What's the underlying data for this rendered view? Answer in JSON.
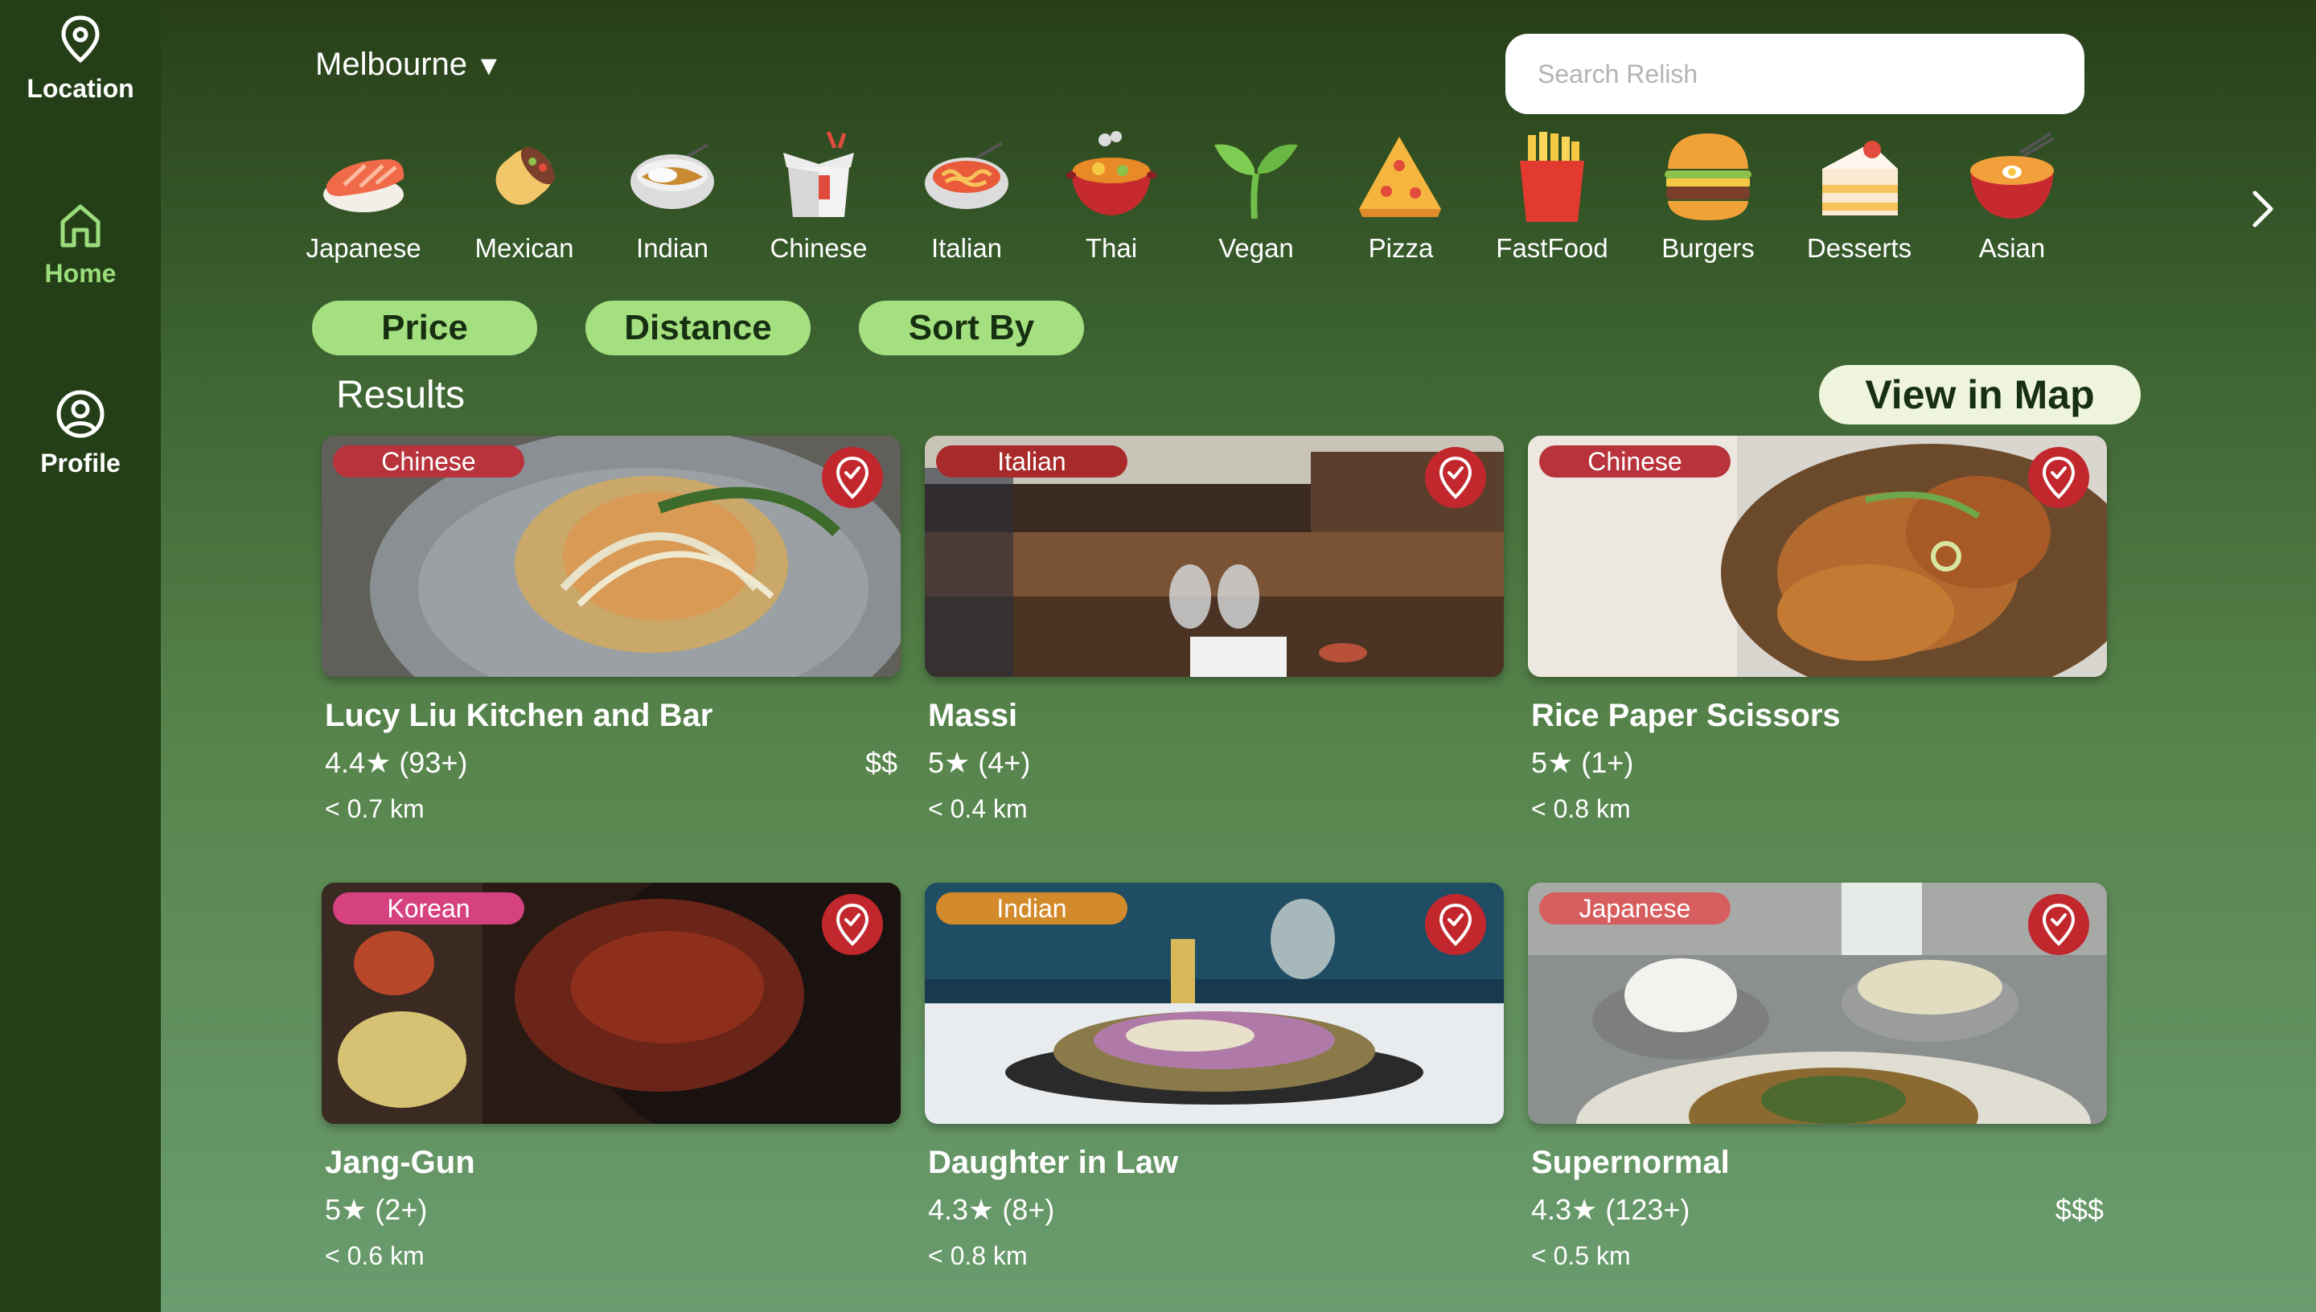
{
  "sidebar": {
    "items": [
      {
        "label": "Location",
        "icon": "map-pin-icon",
        "active": false
      },
      {
        "label": "Home",
        "icon": "home-icon",
        "active": true
      },
      {
        "label": "Profile",
        "icon": "user-circle-icon",
        "active": false
      }
    ],
    "active_color": "#9bdc7b"
  },
  "header": {
    "city": "Melbourne",
    "city_caret": "▼",
    "search_placeholder": "Search Relish",
    "search_value": ""
  },
  "categories": [
    {
      "label": "Japanese",
      "icon": "sushi-icon"
    },
    {
      "label": "Mexican",
      "icon": "burrito-icon"
    },
    {
      "label": "Indian",
      "icon": "curry-icon"
    },
    {
      "label": "Chinese",
      "icon": "takeout-box-icon"
    },
    {
      "label": "Italian",
      "icon": "pasta-icon"
    },
    {
      "label": "Thai",
      "icon": "hot-pot-icon"
    },
    {
      "label": "Vegan",
      "icon": "seedling-icon"
    },
    {
      "label": "Pizza",
      "icon": "pizza-icon"
    },
    {
      "label": "FastFood",
      "icon": "fries-icon"
    },
    {
      "label": "Burgers",
      "icon": "burger-icon"
    },
    {
      "label": "Desserts",
      "icon": "cake-icon"
    },
    {
      "label": "Asian",
      "icon": "ramen-icon"
    }
  ],
  "filters": [
    "Price",
    "Distance",
    "Sort By"
  ],
  "results": {
    "title": "Results",
    "view_map_label": "View in Map",
    "cards": [
      {
        "name": "Lucy Liu Kitchen and Bar",
        "rating": "4.4★ (93+)",
        "price": "$$",
        "distance": "< 0.7 km",
        "tag": "Chinese",
        "tag_color": "#b8333b"
      },
      {
        "name": "Massi",
        "rating": "5★ (4+)",
        "price": "",
        "distance": "< 0.4 km",
        "tag": "Italian",
        "tag_color": "#a82a2a"
      },
      {
        "name": "Rice Paper Scissors",
        "rating": "5★ (1+)",
        "price": "",
        "distance": "< 0.8 km",
        "tag": "Chinese",
        "tag_color": "#b8333b"
      },
      {
        "name": "Jang-Gun",
        "rating": "5★ (2+)",
        "price": "",
        "distance": "< 0.6 km",
        "tag": "Korean",
        "tag_color": "#d6427f"
      },
      {
        "name": "Daughter in Law",
        "rating": "4.3★ (8+)",
        "price": "",
        "distance": "< 0.8 km",
        "tag": "Indian",
        "tag_color": "#d38a2a"
      },
      {
        "name": "Supernormal",
        "rating": "4.3★ (123+)",
        "price": "$$$",
        "distance": "< 0.5 km",
        "tag": "Japanese",
        "tag_color": "#d75e5e"
      }
    ]
  },
  "colors": {
    "sidebar_bg": "#243f18",
    "filter_bg": "#a4e07f",
    "view_map_bg": "#eef5dc",
    "favorite_red": "#c1272d"
  }
}
